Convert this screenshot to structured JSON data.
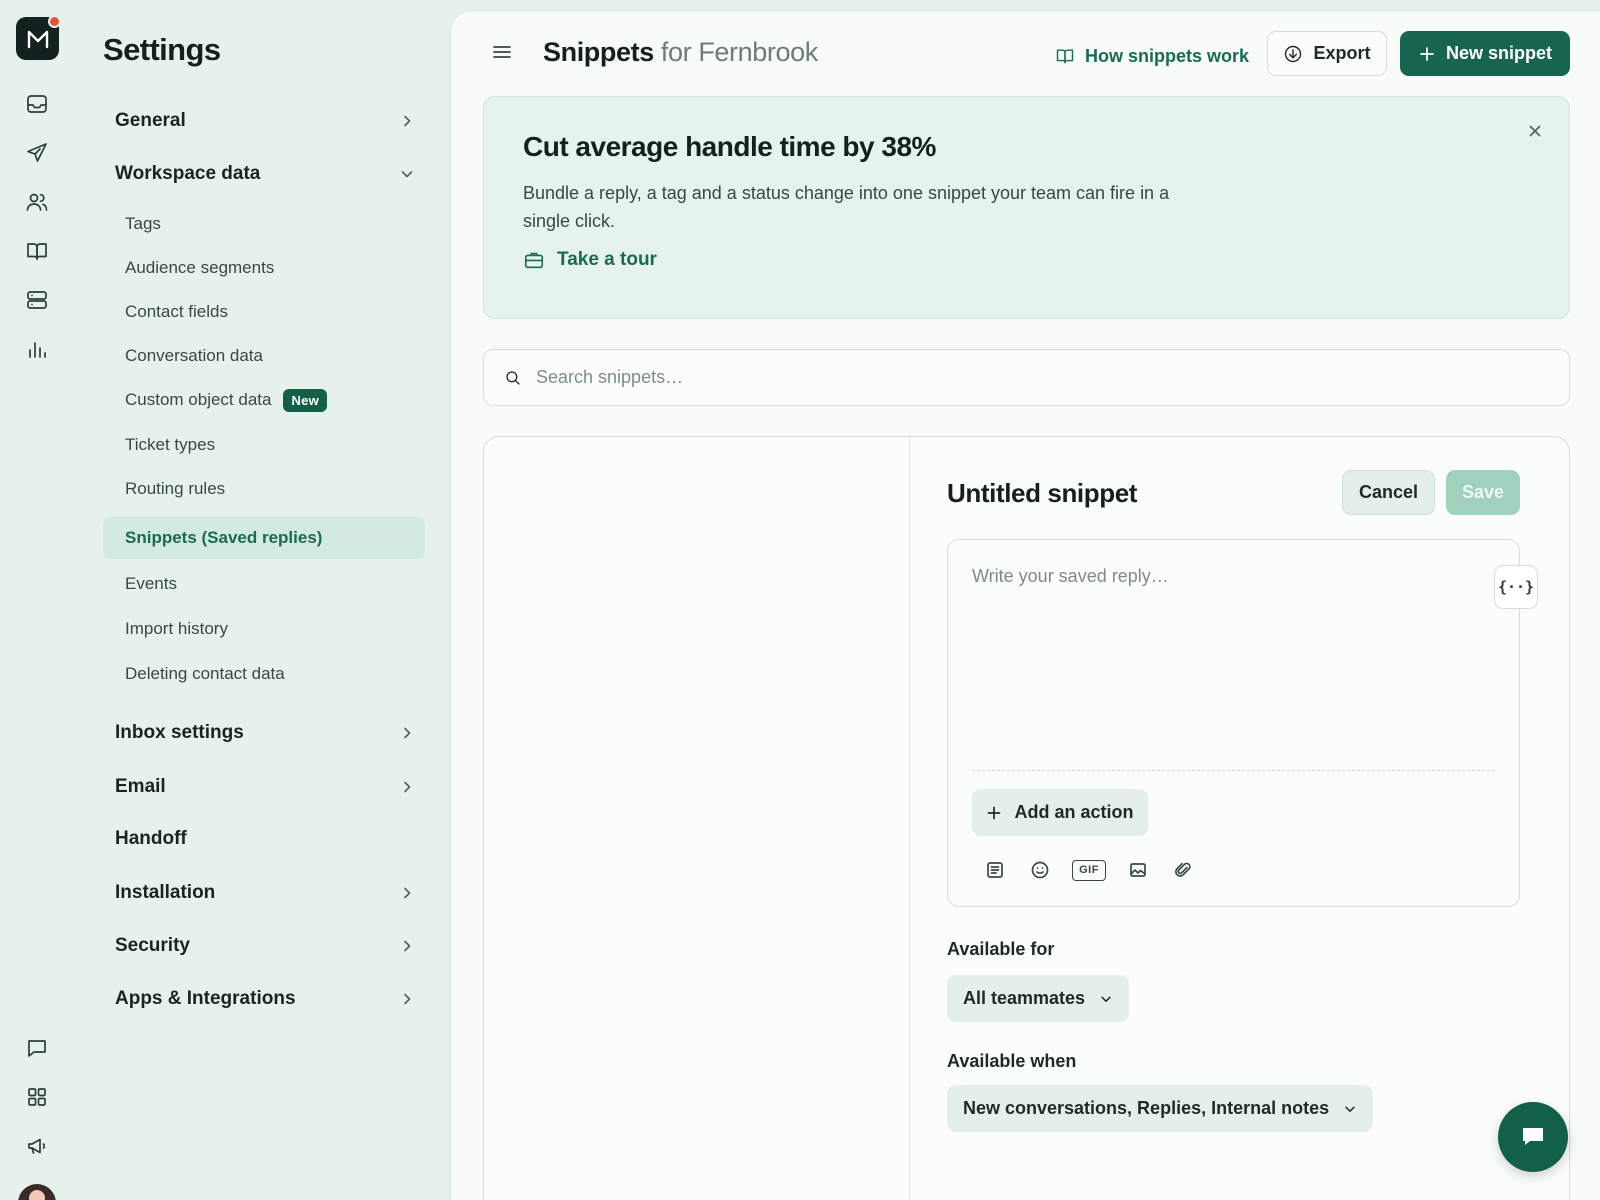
{
  "rail": {
    "logo_letter": "M",
    "items": [
      {
        "icon": "inbox-icon"
      },
      {
        "icon": "send-icon"
      },
      {
        "icon": "contacts-icon"
      },
      {
        "icon": "book-icon"
      },
      {
        "icon": "database-icon"
      },
      {
        "icon": "reports-icon"
      }
    ],
    "bottom_items": [
      {
        "icon": "chat-bubble-icon"
      },
      {
        "icon": "apps-grid-icon"
      },
      {
        "icon": "megaphone-icon"
      }
    ]
  },
  "settings": {
    "title": "Settings",
    "sections": {
      "general": "General",
      "workspace_data": "Workspace data",
      "inbox_settings": "Inbox settings",
      "email": "Email",
      "handoff": "Handoff",
      "installation": "Installation",
      "security": "Security",
      "apps": "Apps & Integrations"
    },
    "workspace_items": [
      {
        "label": "Tags"
      },
      {
        "label": "Audience segments"
      },
      {
        "label": "Contact fields"
      },
      {
        "label": "Conversation data"
      },
      {
        "label": "Custom object data",
        "badge": "New"
      },
      {
        "label": "Ticket types"
      },
      {
        "label": "Routing rules"
      },
      {
        "label": "Snippets (Saved replies)",
        "active": true
      },
      {
        "label": "Events"
      },
      {
        "label": "Import history"
      },
      {
        "label": "Deleting contact data"
      }
    ]
  },
  "header": {
    "title": "Snippets",
    "title_suffix": "for Fernbrook",
    "how_link": "How snippets work",
    "export_label": "Export",
    "new_label": "New snippet"
  },
  "promo": {
    "title": "Cut average handle time by 38%",
    "body": "Bundle a reply, a tag and a status change into one snippet your team can fire in a single click.",
    "tour_label": "Take a tour"
  },
  "search": {
    "placeholder": "Search snippets…"
  },
  "editor": {
    "title": "Untitled snippet",
    "cancel_label": "Cancel",
    "save_label": "Save",
    "reply_placeholder": "Write your saved reply…",
    "variable_label": "{··}",
    "add_action_label": "Add an action",
    "gif_label": "GIF",
    "available_for_label": "Available for",
    "available_for_value": "All teammates",
    "available_when_label": "Available when",
    "available_when_value": "New conversations, Replies, Internal notes"
  },
  "colors": {
    "brand": "#17654e",
    "accent_text": "#1b6a52",
    "background": "#e7f1ec",
    "notification_dot": "#e8543a"
  }
}
